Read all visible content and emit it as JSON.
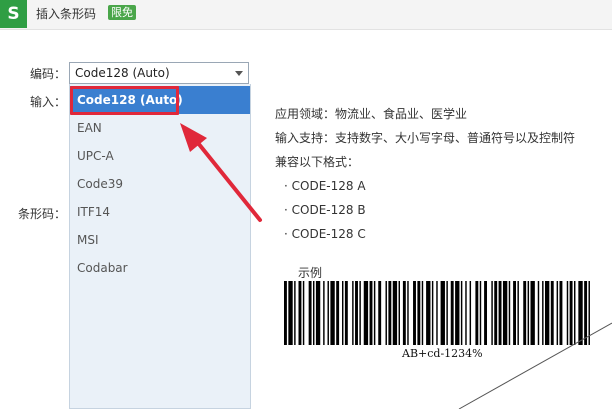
{
  "window": {
    "logo_letter": "S",
    "title": "插入条形码",
    "badge": "限免"
  },
  "form": {
    "encoding_label": "编码：",
    "input_label": "输入：",
    "barcode_label": "条形码：",
    "encoding_value": "Code128 (Auto)"
  },
  "dropdown": {
    "selected_index": 0,
    "options": [
      "Code128 (Auto)",
      "EAN",
      "UPC-A",
      "Code39",
      "ITF14",
      "MSI",
      "Codabar"
    ]
  },
  "info": {
    "application": "应用领域：物流业、食品业、医学业",
    "support": "输入支持：支持数字、大小写字母、普通符号以及控制符",
    "compat_heading": "兼容以下格式：",
    "formats": [
      "· CODE-128 A",
      "· CODE-128 B",
      "· CODE-128 C"
    ]
  },
  "sample": {
    "label": "示例",
    "text": "AB+cd-1234%"
  },
  "colors": {
    "logo_bg": "#2f9e44",
    "badge_bg": "#4aa64a",
    "selected_bg": "#3a7fd0",
    "dropdown_bg": "#eaf1f8",
    "annotation_red": "#e0283a"
  }
}
